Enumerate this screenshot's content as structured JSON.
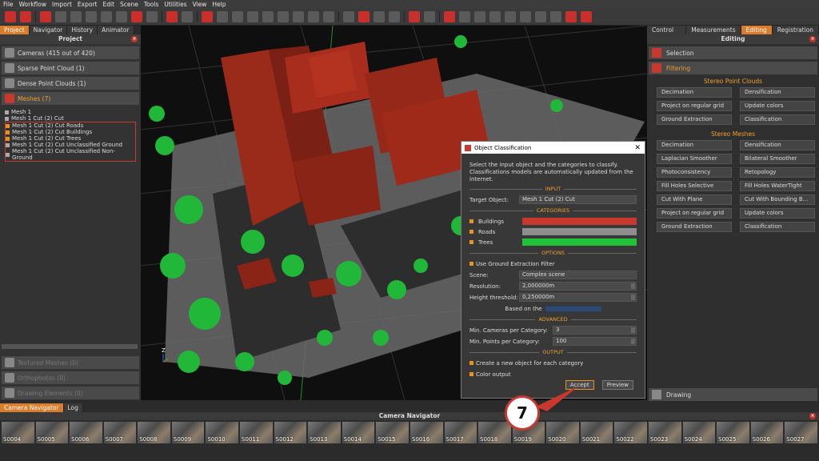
{
  "menubar": {
    "items": [
      "File",
      "Workflow",
      "Import",
      "Export",
      "Edit",
      "Scene",
      "Tools",
      "Utilities",
      "View",
      "Help"
    ]
  },
  "left_panel": {
    "tabs": [
      "Project",
      "Navigator",
      "History",
      "Animator"
    ],
    "active_tab": "Project",
    "title": "Project",
    "sections": {
      "cameras": "Cameras (415 out of 420)",
      "sparse": "Sparse Point Cloud (1)",
      "dense": "Dense Point Clouds (1)",
      "meshes": "Meshes (7)",
      "textured": "Textured Meshes (0)",
      "ortho": "Orthophotos (0)",
      "drawing": "Drawing Elements (0)"
    },
    "mesh_items": [
      "Mesh 1",
      "Mesh 1 Cut (2) Cut",
      "Mesh 1 Cut (2) Cut Roads",
      "Mesh 1 Cut (2) Cut Buildings",
      "Mesh 1 Cut (2) Cut Trees",
      "Mesh 1 Cut (2) Cut Unclassified Ground",
      "Mesh 1 Cut (2) Cut Unclassified Non-Ground"
    ]
  },
  "right_panel": {
    "tabs": [
      "Control points",
      "Measurements",
      "Editing",
      "Registration"
    ],
    "active_tab": "Editing",
    "title": "Editing",
    "selection": "Selection",
    "filtering": "Filtering",
    "stereo_point_clouds_title": "Stereo Point Clouds",
    "spc_buttons": [
      "Decimation",
      "Densification",
      "Project on regular grid",
      "Update colors",
      "Ground Extraction",
      "Classification"
    ],
    "stereo_meshes_title": "Stereo Meshes",
    "sm_buttons": [
      "Decimation",
      "Densification",
      "Laplacian Smoother",
      "Bilateral Smoother",
      "Photoconsistency",
      "Retopology",
      "Fill Holes Selective",
      "Fill Holes WaterTight",
      "Cut With Plane",
      "Cut With Bounding B...",
      "Project on regular grid",
      "Update colors",
      "Ground Extraction",
      "Classification"
    ],
    "drawing": "Drawing"
  },
  "dialog": {
    "title": "Object Classification",
    "description": "Select the input object and the categories to classify. Classifications models are automatically updated from the internet.",
    "input_label": "INPUT",
    "target_label": "Target Object:",
    "target_value": "Mesh 1 Cut (2) Cut",
    "categories_label": "CATEGORIES",
    "categories": [
      {
        "name": "Buildings",
        "color": "#c8382f"
      },
      {
        "name": "Roads",
        "color": "#8e8e8e"
      },
      {
        "name": "Trees",
        "color": "#22c23a"
      }
    ],
    "options_label": "OPTIONS",
    "ground_filter": "Use Ground Extraction Filter",
    "scene_label": "Scene:",
    "scene_value": "Complex scene",
    "resolution_label": "Resolution:",
    "resolution_value": "2,000000m",
    "height_label": "Height threshold:",
    "height_value": "0,250000m",
    "based_on": "Based on the",
    "advanced_label": "ADVANCED",
    "min_cams_label": "Min. Cameras per Category:",
    "min_cams_value": "3",
    "min_pts_label": "Min. Points per Category:",
    "min_pts_value": "100",
    "output_label": "OUTPUT",
    "create_new": "Create a new object for each category",
    "color_output": "Color output",
    "accept": "Accept",
    "preview": "Preview"
  },
  "bottom_panel": {
    "tabs": [
      "Camera Navigator",
      "Log"
    ],
    "active_tab": "Camera Navigator",
    "title": "Camera Navigator",
    "thumbnails": [
      "S0004",
      "S0005",
      "S0006",
      "S0007",
      "S0008",
      "S0009",
      "S0010",
      "S0011",
      "S0012",
      "S0013",
      "S0014",
      "S0015",
      "S0016",
      "S0017",
      "S0018",
      "S0019",
      "S0020",
      "S0021",
      "S0022",
      "S0023",
      "S0024",
      "S0025",
      "S0026",
      "S0027"
    ]
  },
  "callout": {
    "number": "7"
  },
  "axis": {
    "z": "Z"
  }
}
